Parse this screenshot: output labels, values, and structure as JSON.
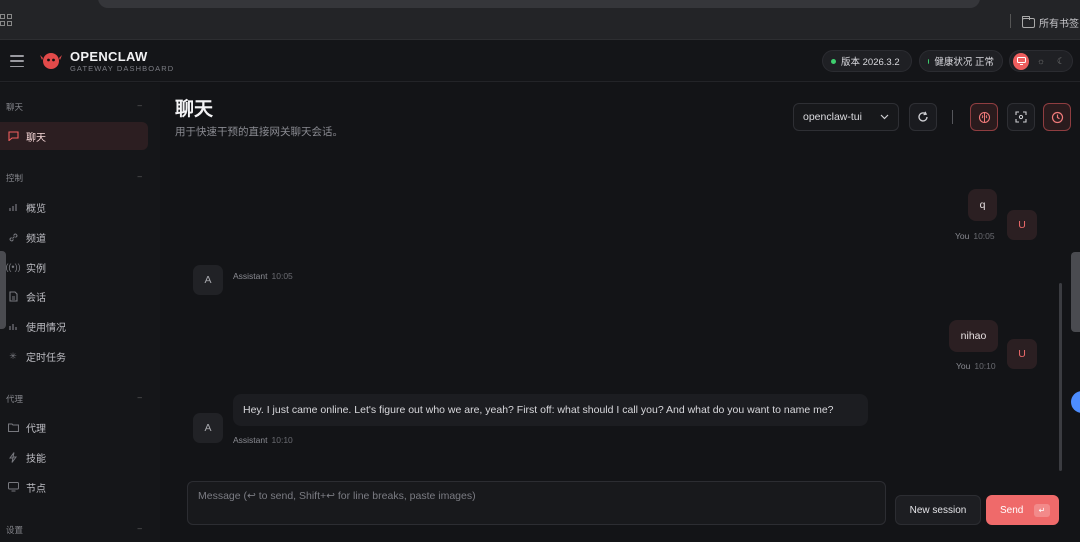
{
  "browser": {
    "bookmarks_label": "所有书签"
  },
  "header": {
    "brand_title": "OPENCLAW",
    "brand_subtitle": "GATEWAY DASHBOARD",
    "version_label": "版本 2026.3.2",
    "health_label": "健康状况 正常",
    "status_color": "#3ecf6e",
    "accent_color": "#ef5e5e"
  },
  "sidebar": {
    "sections": {
      "chat": "聊天",
      "control": "控制",
      "agent": "代理",
      "settings": "设置"
    },
    "items": {
      "chat": "聊天",
      "overview": "概览",
      "channels": "频道",
      "instances": "实例",
      "sessions": "会话",
      "usage": "使用情况",
      "cron": "定时任务",
      "agents": "代理",
      "skills": "技能",
      "nodes": "节点"
    }
  },
  "main": {
    "title": "聊天",
    "subtitle": "用于快速干预的直接网关聊天会话。",
    "session_select": "openclaw-tui"
  },
  "messages": [
    {
      "role": "user",
      "text": "q",
      "sender": "You",
      "time": "10:05",
      "avatar": "U"
    },
    {
      "role": "assistant",
      "text": "",
      "sender": "Assistant",
      "time": "10:05",
      "avatar": "A"
    },
    {
      "role": "user",
      "text": "nihao",
      "sender": "You",
      "time": "10:10",
      "avatar": "U"
    },
    {
      "role": "assistant",
      "text": "Hey. I just came online. Let's figure out who we are, yeah? First off: what should I call you? And what do you want to name me?",
      "sender": "Assistant",
      "time": "10:10",
      "avatar": "A"
    }
  ],
  "composer": {
    "placeholder": "Message (↩ to send, Shift+↩ for line breaks, paste images)",
    "new_session_label": "New session",
    "send_label": "Send",
    "send_key": "↵"
  }
}
